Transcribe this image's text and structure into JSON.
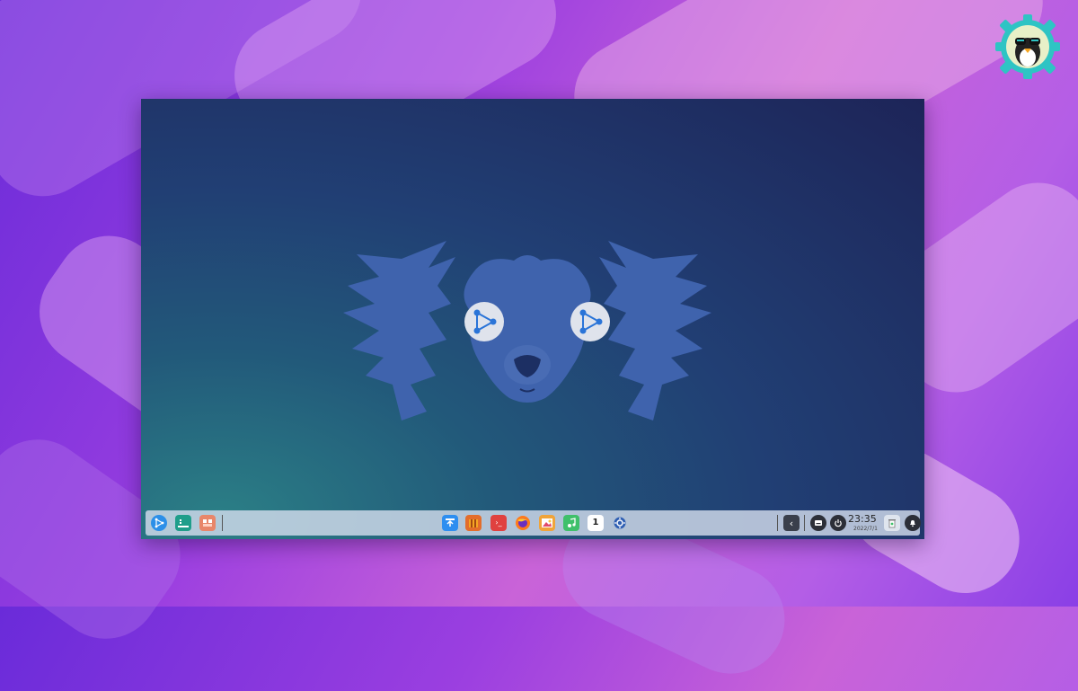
{
  "wallpaper": {
    "colors": {
      "primary": "#9b3fe0",
      "secondary": "#c963d8"
    }
  },
  "badge": {
    "icon": "gear-penguin-logo-icon"
  },
  "desktop": {
    "wallpaper_icon": "mascot-face-icon",
    "eye_icon": "share-triangle-icon"
  },
  "taskbar": {
    "left": [
      {
        "name": "launcher-button",
        "icon": "share-triangle-icon",
        "color": "#2b8fe8"
      },
      {
        "name": "terminal-view-button",
        "icon": "terminal-icon",
        "color": "#1f9e8a"
      },
      {
        "name": "multitask-button",
        "icon": "multitask-icon",
        "color": "#e8866a"
      }
    ],
    "center": [
      {
        "name": "app-store-button",
        "icon": "app-store-icon",
        "color": "#2d8ef0"
      },
      {
        "name": "archive-manager-button",
        "icon": "archive-icon",
        "color": "#e36d2b"
      },
      {
        "name": "terminal-button",
        "icon": "terminal-red-icon",
        "color": "#e0413f"
      },
      {
        "name": "firefox-button",
        "icon": "firefox-icon",
        "color": "#ff7a1a"
      },
      {
        "name": "image-viewer-button",
        "icon": "photos-icon",
        "color": "#f0a43a"
      },
      {
        "name": "music-button",
        "icon": "music-icon",
        "color": "#3fc06a"
      },
      {
        "name": "calendar-button",
        "icon": "calendar-icon",
        "color": "#ffffff"
      },
      {
        "name": "settings-button",
        "icon": "gear-icon",
        "color": "#2f5fb3"
      }
    ],
    "tray": {
      "collapse_icon": "chevron-left-icon",
      "keyboard_icon": "keyboard-icon",
      "power_icon": "power-icon",
      "trash_icon": "trash-icon",
      "notification_icon": "bell-icon"
    },
    "glyphs": {
      "terminal": "›_",
      "calendar": "1",
      "collapse": "‹"
    },
    "clock": {
      "time": "23:35",
      "date": "2022/7/1"
    }
  }
}
